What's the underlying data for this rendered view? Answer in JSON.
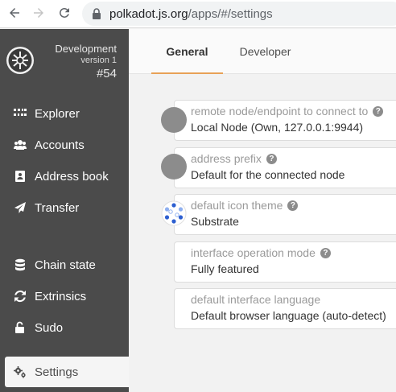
{
  "browser": {
    "url_host": "polkadot.js.org",
    "url_path": "/apps/#/settings"
  },
  "chain": {
    "name": "Development",
    "version": "version 1",
    "block": "#54"
  },
  "sidebar": {
    "items": [
      {
        "label": "Explorer",
        "icon": "explorer-icon"
      },
      {
        "label": "Accounts",
        "icon": "users-icon"
      },
      {
        "label": "Address book",
        "icon": "address-book-icon"
      },
      {
        "label": "Transfer",
        "icon": "paper-plane-icon"
      },
      {
        "label": "Chain state",
        "icon": "database-icon"
      },
      {
        "label": "Extrinsics",
        "icon": "sync-icon"
      },
      {
        "label": "Sudo",
        "icon": "unlock-icon"
      },
      {
        "label": "Settings",
        "icon": "gears-icon",
        "active": true
      }
    ]
  },
  "tabs": [
    {
      "label": "General",
      "active": true
    },
    {
      "label": "Developer",
      "active": false
    }
  ],
  "settings": {
    "endpoint": {
      "label": "remote node/endpoint to connect to",
      "value": "Local Node (Own, 127.0.0.1:9944)"
    },
    "prefix": {
      "label": "address prefix",
      "value": "Default for the connected node"
    },
    "icon_theme": {
      "label": "default icon theme",
      "value": "Substrate"
    },
    "ui_mode": {
      "label": "interface operation mode",
      "value": "Fully featured"
    },
    "language": {
      "label": "default interface language",
      "value": "Default browser language (auto-detect)"
    }
  },
  "colors": {
    "sidebar_bg": "#4b4b4b",
    "tab_accent": "#e8a157",
    "help_icon": "#8c8c8c"
  }
}
